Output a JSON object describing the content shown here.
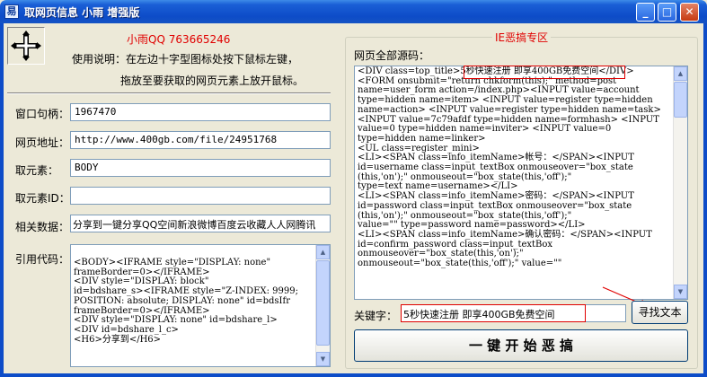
{
  "window": {
    "title": "取网页信息 小雨 增强版",
    "icon_name": "app-icon",
    "buttons": {
      "minimize": "_",
      "maximize": "□",
      "close": "✕"
    }
  },
  "left": {
    "qq": "小雨QQ  763665246",
    "instruction_line1": "使用说明：在左边十字型图标处按下鼠标左键，",
    "instruction_line2": "拖放至要获取的网页元素上放开鼠标。",
    "fields": {
      "window_handle": {
        "label": "窗口句柄：",
        "value": "1967470"
      },
      "page_url": {
        "label": "网页地址：",
        "value": "http://www.400gb.com/file/24951768"
      },
      "element": {
        "label": "取元素：",
        "value": "BODY"
      },
      "element_id": {
        "label": "取元素ID：",
        "value": ""
      },
      "related_data": {
        "label": "相关数据：",
        "value": "分享到一键分享QQ空间新浪微博百度云收藏人人网腾讯"
      },
      "reference_code": {
        "label": "引用代码：",
        "text": "<BODY><IFRAME style=\"DISPLAY: none\"\nframeBorder=0></IFRAME>\n<DIV style=\"DISPLAY: block\"\nid=bdshare_s><IFRAME style=\"Z-INDEX: 9999;\nPOSITION: absolute; DISPLAY: none\" id=bdsIfr\nframeBorder=0></IFRAME>\n<DIV style=\"DISPLAY: none\" id=bdshare_l>\n<DIV id=bdshare_l_c>\n<H6>分享到</H6>"
      }
    }
  },
  "right": {
    "group_title": "IE恶搞专区",
    "source_label": "网页全部源码：",
    "source_text": "<DIV class=top_title>5秒快速注册 即享400GB免费空间</DIV>\n<FORM onsubmit=\"return chkform(this);\" method=post\nname=user_form action=/index.php><INPUT value=account\ntype=hidden name=item> <INPUT value=register type=hidden\nname=action> <INPUT value=register type=hidden name=task>\n<INPUT value=7c79afdf type=hidden name=formhash> <INPUT\nvalue=0 type=hidden name=inviter> <INPUT value=0\ntype=hidden name=linker>\n<UL class=register_mini>\n<LI><SPAN class=info_itemName>帐号：</SPAN><INPUT\nid=username class=input_textBox onmouseover=\"box_state\n(this,'on');\" onmouseout=\"box_state(this,'off');\"\ntype=text name=username></LI>\n<LI><SPAN class=info_itemName>密码：</SPAN><INPUT\nid=password class=input_textBox onmouseover=\"box_state\n(this,'on');\" onmouseout=\"box_state(this,'off');\"\nvalue=\"\" type=password name=password></LI>\n<LI><SPAN class=info_itemName>确认密码：</SPAN><INPUT\nid=confirm_password class=input_textBox\nonmouseover=\"box_state(this,'on');\"\nonmouseout=\"box_state(this,'off');\" value=\"\"",
    "keyword_label": "关键字：",
    "keyword_value": "5秒快速注册 即享400GB免费空间",
    "find_button": "寻找文本",
    "prank_button": "一 键 开 始 恶 搞"
  },
  "colors": {
    "accent_red": "#e00000",
    "titlebar_blue": "#0d4cc8"
  }
}
